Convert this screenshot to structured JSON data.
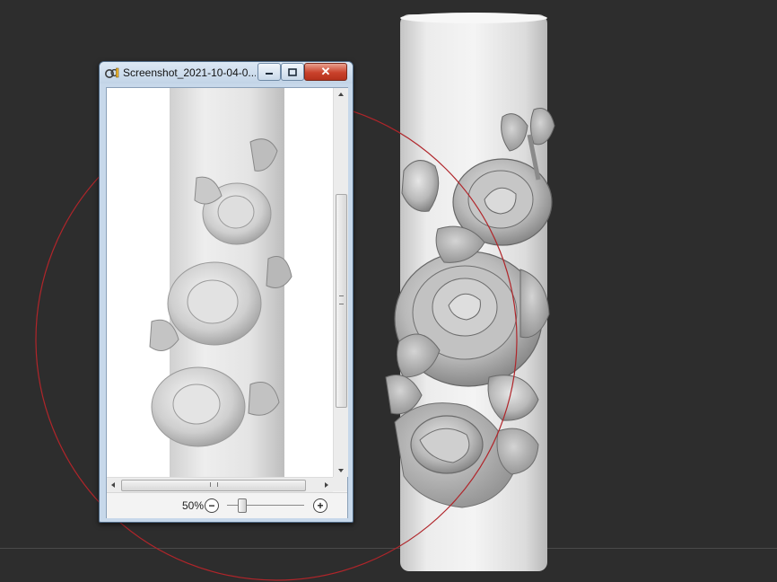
{
  "viewer_window": {
    "title": "Screenshot_2021-10-04-0...",
    "close_glyph": "✕",
    "zoom_level": "50%",
    "zoom_out_glyph": "−",
    "zoom_in_glyph": "+",
    "zoom_slider_fraction": 0.2
  },
  "colors": {
    "viewport_background": "#2d2d2d",
    "selection_circle": "#b0252a",
    "close_button": "#c9412b",
    "window_frame": "#c7d8ea"
  },
  "icons": [
    "photo-viewer-app-icon",
    "minimize-icon",
    "maximize-icon",
    "close-icon",
    "zoom-out-icon",
    "zoom-in-icon",
    "scroll-arrow-icon"
  ]
}
